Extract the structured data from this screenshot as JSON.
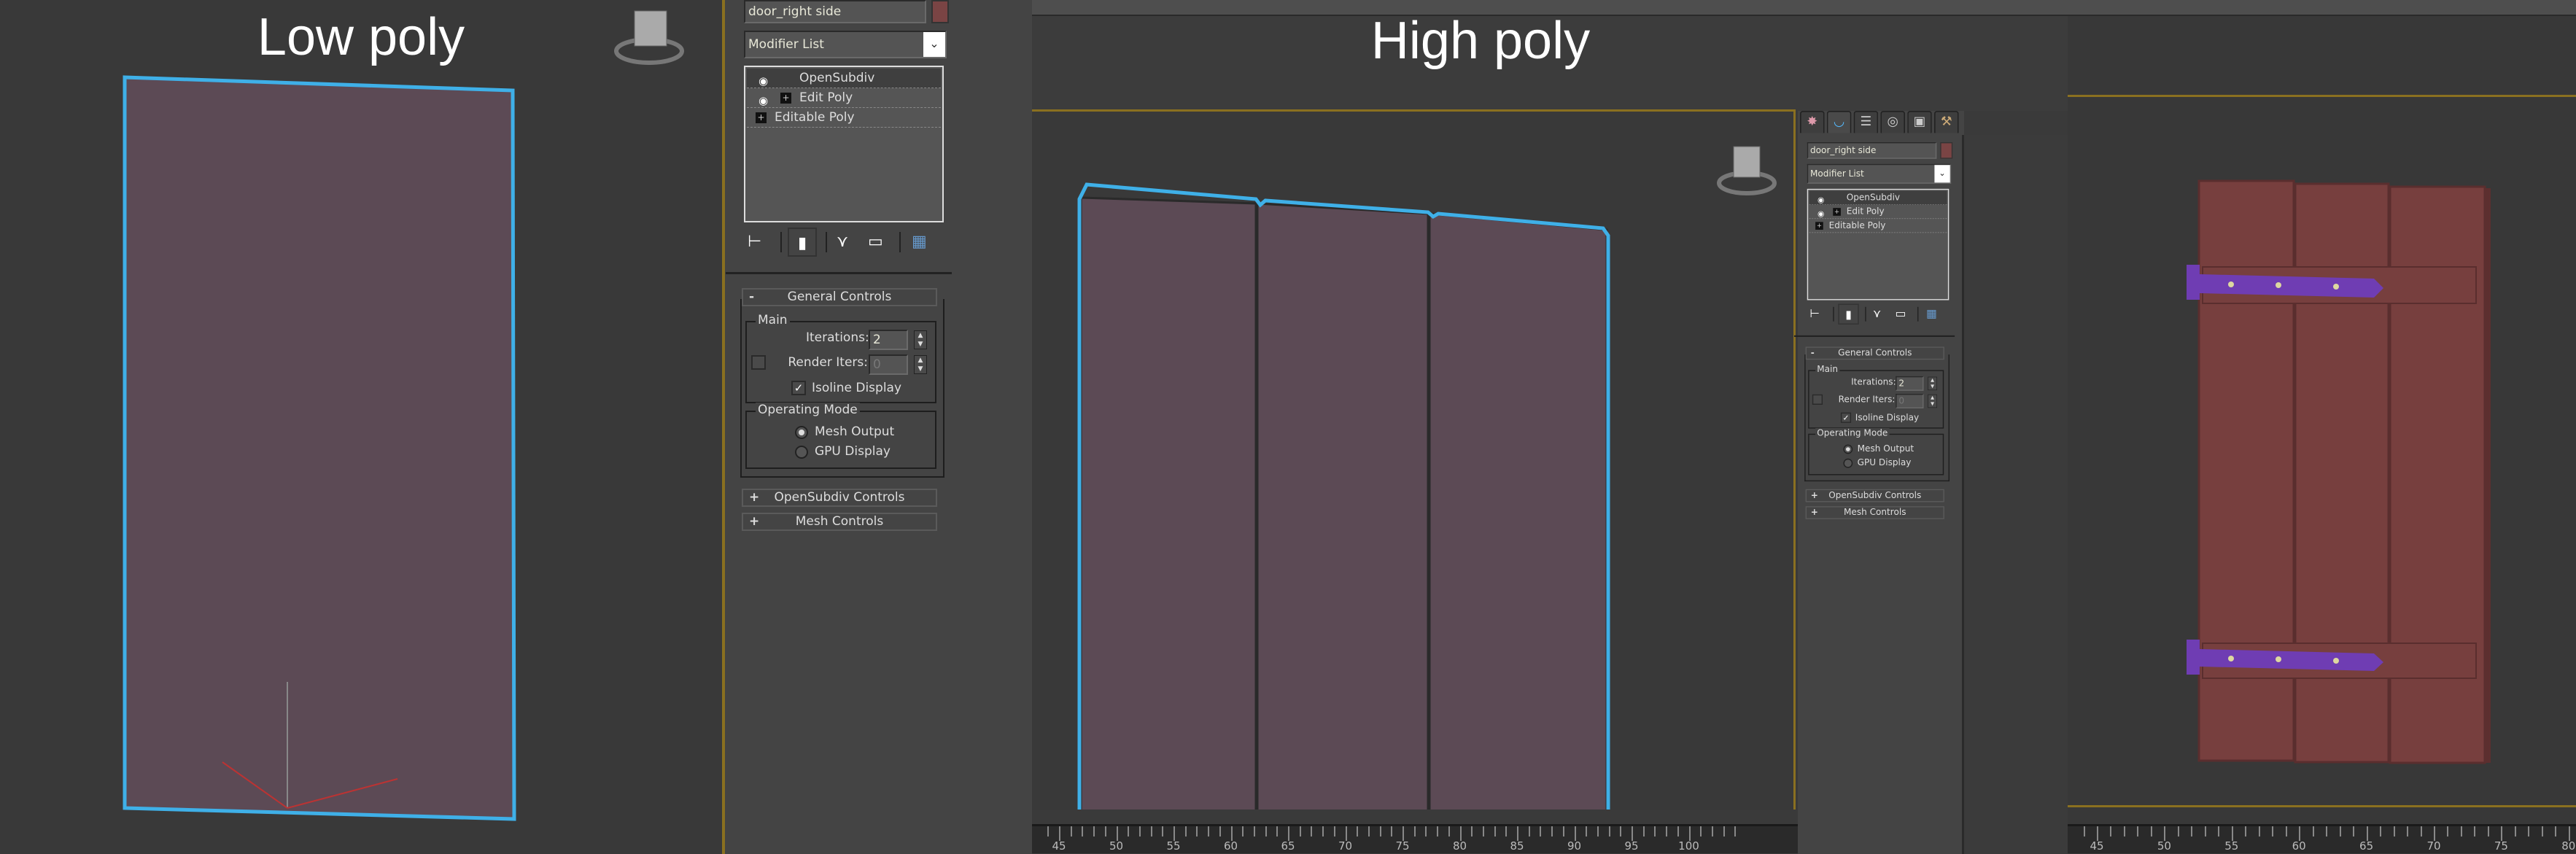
{
  "labels": {
    "low_poly": "Low poly",
    "high_poly": "High poly"
  },
  "panel": {
    "object_name": "door_right side",
    "object_color": "#7a4444",
    "modifier_list": "Modifier List",
    "stack": [
      {
        "label": "OpenSubdiv",
        "bulb": true,
        "expand": false,
        "selected": true
      },
      {
        "label": "Edit Poly",
        "bulb": true,
        "expand": true
      },
      {
        "label": "Editable Poly",
        "bulb": false,
        "expand": true
      }
    ],
    "toolbar_icons": [
      "pin-stack-icon",
      "show-end-result-icon",
      "make-unique-icon",
      "remove-modifier-icon",
      "configure-modifier-sets-icon"
    ],
    "general_controls": {
      "title": "General Controls",
      "collapse_sign": "-",
      "main_group": "Main",
      "iterations_label": "Iterations:",
      "iterations_value": "2",
      "render_iters_label": "Render Iters:",
      "render_iters_value": "0",
      "render_iters_enabled": false,
      "isoline_label": "Isoline Display",
      "isoline_checked": true,
      "operating_mode_group": "Operating Mode",
      "mesh_output_label": "Mesh Output",
      "gpu_display_label": "GPU Display",
      "selected_mode": "Mesh Output"
    },
    "opensubdiv_controls": {
      "title": "OpenSubdiv Controls",
      "sign": "+"
    },
    "mesh_controls": {
      "title": "Mesh Controls",
      "sign": "+"
    }
  },
  "command_tabs": [
    "create-icon",
    "modify-icon",
    "hierarchy-icon",
    "motion-icon",
    "display-icon",
    "utilities-icon"
  ],
  "active_tab": "modify-icon",
  "ruler_high": {
    "labels": [
      "45",
      "50",
      "55",
      "60",
      "65",
      "70",
      "75",
      "80",
      "85",
      "90",
      "95",
      "100"
    ]
  },
  "ruler_right": {
    "labels": [
      "45",
      "50",
      "55",
      "60",
      "65",
      "70",
      "75",
      "80"
    ]
  },
  "colors": {
    "selection_outline": "#3fb0e8",
    "low_mesh": "#5c4a55",
    "door_wood": "#773f3e",
    "hinge": "#6f3db3",
    "active_viewport_border": "#8a7020"
  }
}
